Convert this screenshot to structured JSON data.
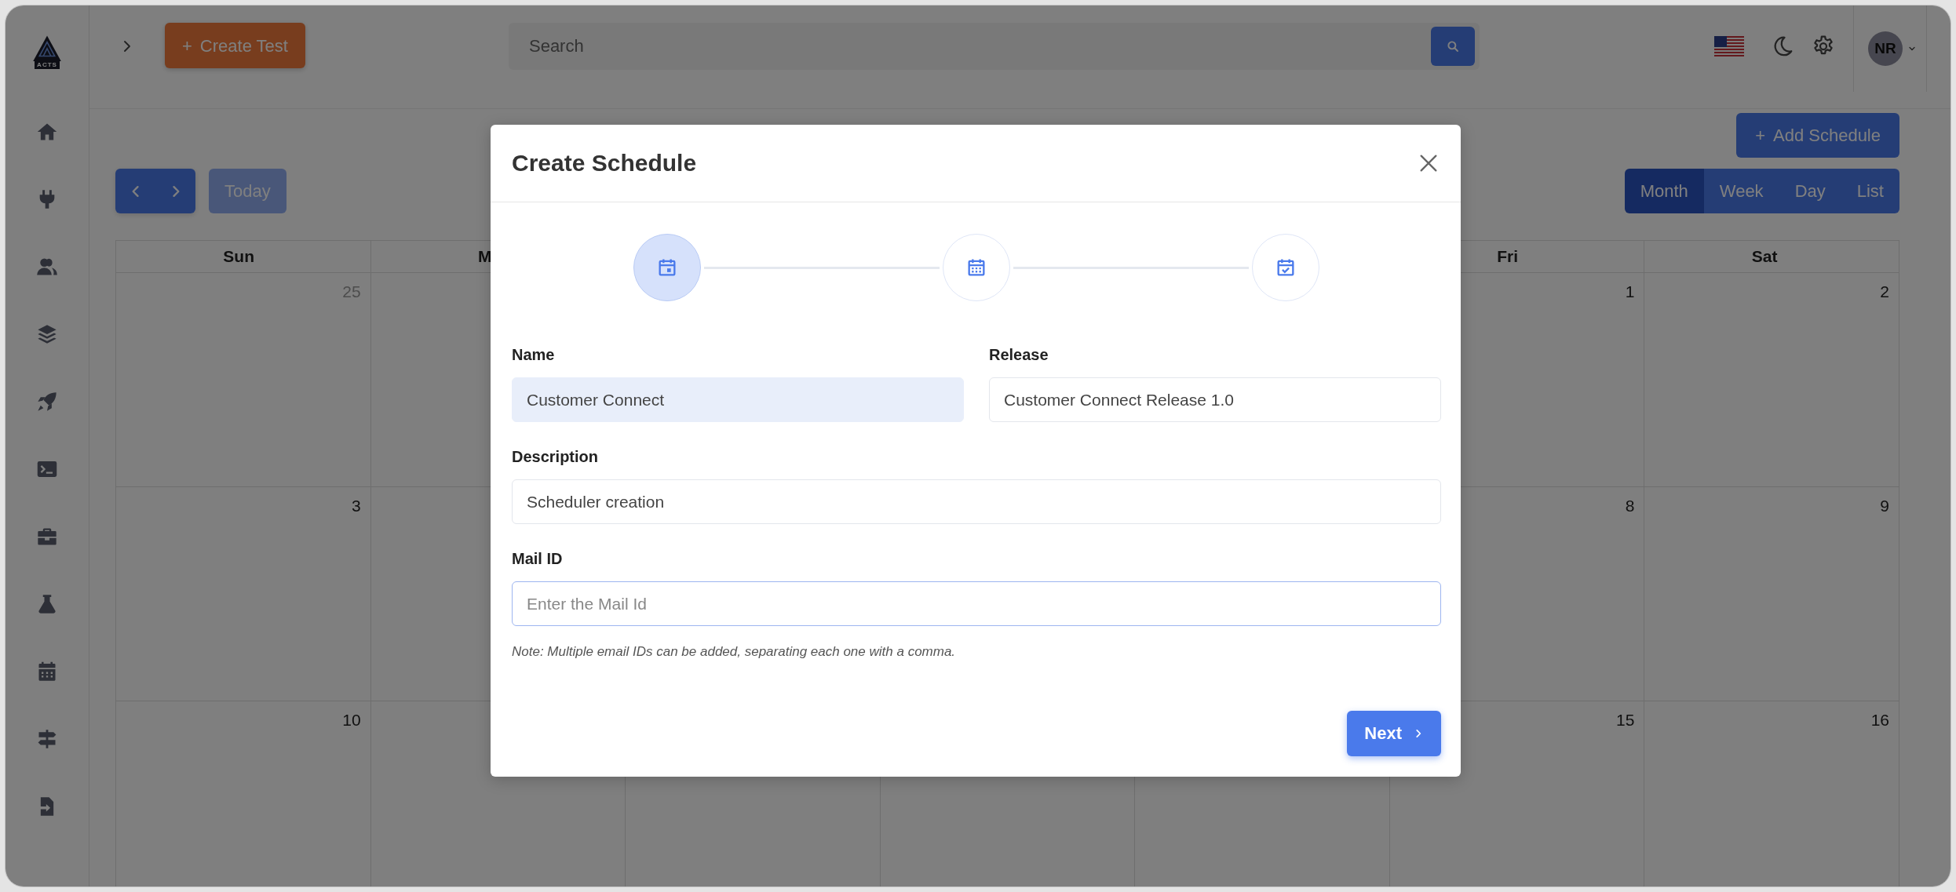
{
  "sidebar": {
    "logo_text": "ACTS",
    "items": [
      {
        "kind": "home"
      },
      {
        "kind": "plug"
      },
      {
        "kind": "users"
      },
      {
        "kind": "layers"
      },
      {
        "kind": "rocket"
      },
      {
        "kind": "terminal"
      },
      {
        "kind": "briefcase"
      },
      {
        "kind": "flask"
      },
      {
        "kind": "calendar"
      },
      {
        "kind": "signpost"
      },
      {
        "kind": "file-import"
      }
    ]
  },
  "header": {
    "create_button": {
      "icon": "+",
      "label": "Create Test"
    },
    "search": {
      "placeholder": "Search"
    },
    "avatar": "NR"
  },
  "toolbar": {
    "add_button": {
      "icon": "+",
      "label": "Add Schedule"
    },
    "today_button": {
      "label": "Today",
      "disabled": true
    },
    "views": [
      {
        "label": "Month",
        "selected": true
      },
      {
        "label": "Week",
        "selected": false
      },
      {
        "label": "Day",
        "selected": false
      },
      {
        "label": "List",
        "selected": false
      }
    ]
  },
  "calendar": {
    "headers": {
      "sun": "Sun",
      "mon": "M",
      "fri": "Fri",
      "sat": "Sat"
    },
    "weeks": [
      {
        "sun": {
          "text": "25",
          "muted": true
        },
        "fri": {
          "text": "1",
          "muted": false
        },
        "sat": {
          "text": "2",
          "muted": false
        }
      },
      {
        "sun": {
          "text": "3",
          "muted": false
        },
        "fri": {
          "text": "8",
          "muted": false
        },
        "sat": {
          "text": "9",
          "muted": false
        }
      },
      {
        "sun": {
          "text": "10",
          "muted": false
        },
        "fri": {
          "text": "15",
          "muted": false
        },
        "sat": {
          "text": "16",
          "muted": false
        }
      }
    ]
  },
  "modal": {
    "title": "Create Schedule",
    "steps": [
      {
        "kind": "calendar-day",
        "selected": true
      },
      {
        "kind": "calendar-grid",
        "selected": false
      },
      {
        "kind": "calendar-check",
        "selected": false
      }
    ],
    "rows": [
      [
        {
          "label": "Name",
          "value": "Customer Connect",
          "highlighted": true,
          "focused": false
        },
        {
          "label": "Release",
          "value": "Customer Connect Release 1.0",
          "highlighted": false,
          "focused": false
        }
      ],
      [
        {
          "label": "Description",
          "value": "Scheduler creation",
          "highlighted": false,
          "focused": false
        }
      ],
      [
        {
          "label": "Mail ID",
          "placeholder": "Enter the Mail Id",
          "highlighted": false,
          "focused": true
        }
      ]
    ],
    "note": "Note: Multiple email IDs can be added, separating each one with a comma.",
    "next_button": "Next"
  }
}
